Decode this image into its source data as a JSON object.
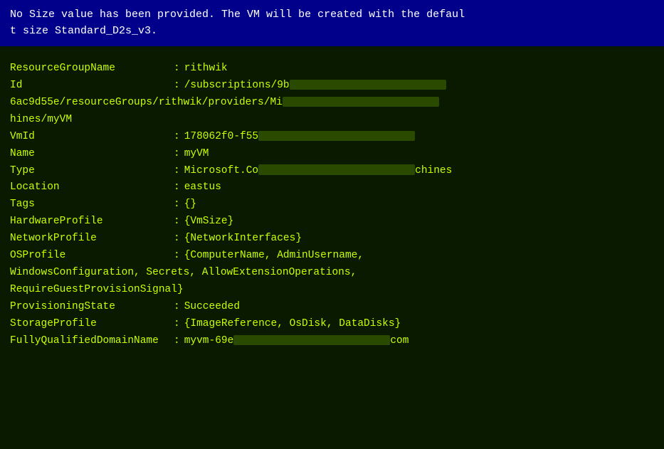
{
  "terminal": {
    "warning": {
      "line1": "No Size value has been provided. The VM will be created with the defaul",
      "line2": "t size Standard_D2s_v3."
    },
    "fields": [
      {
        "key": "ResourceGroupName",
        "value": "rithwik",
        "redacted": false,
        "multiline": false
      },
      {
        "key": "Id",
        "value_prefix": "/subscriptions/9b",
        "redacted": true,
        "continuation": "6ac9d55e/resourceGroups/rithwik/providers/Mi",
        "continuation2": "hines/myVM",
        "multiline": true,
        "type": "id"
      },
      {
        "key": "VmId",
        "value_prefix": "178062f0-f55",
        "redacted": true,
        "multiline": false,
        "type": "vmid"
      },
      {
        "key": "Name",
        "value": "myVM",
        "redacted": false,
        "multiline": false
      },
      {
        "key": "Type",
        "value_prefix": "Microsoft.Co",
        "value_suffix": "chines",
        "redacted": true,
        "multiline": false,
        "type": "type"
      },
      {
        "key": "Location",
        "value": "eastus",
        "redacted": false,
        "multiline": false
      },
      {
        "key": "Tags",
        "value": "{}",
        "redacted": false,
        "multiline": false
      },
      {
        "key": "HardwareProfile",
        "value": "{VmSize}",
        "redacted": false,
        "multiline": false
      },
      {
        "key": "NetworkProfile",
        "value": "{NetworkInterfaces}",
        "redacted": false,
        "multiline": false
      },
      {
        "key": "OSProfile",
        "value": "{ComputerName, AdminUsername,",
        "continuation": "WindowsConfiguration, Secrets, AllowExtensionOperations,",
        "continuation2": "RequireGuestProvisionSignal}",
        "redacted": false,
        "multiline": true,
        "type": "osprofile"
      },
      {
        "key": "ProvisioningState",
        "value": "Succeeded",
        "redacted": false,
        "multiline": false
      },
      {
        "key": "StorageProfile",
        "value": "{ImageReference, OsDisk, DataDisks}",
        "redacted": false,
        "multiline": false
      },
      {
        "key": "FullyQualifiedDomainName",
        "value_prefix": "myvm-69e",
        "value_suffix": "com",
        "redacted": true,
        "multiline": false,
        "type": "fqdn"
      }
    ]
  }
}
